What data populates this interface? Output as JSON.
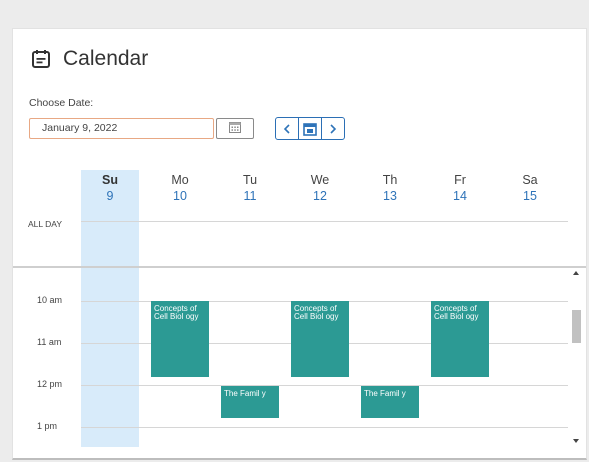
{
  "header": {
    "title": "Calendar",
    "icon": "calendar-icon"
  },
  "date_picker": {
    "label": "Choose Date:",
    "value": "January 9, 2022",
    "button_icon": "calendar-grid-icon"
  },
  "nav": {
    "prev_icon": "chevron-left-icon",
    "today_icon": "calendar-today-icon",
    "next_icon": "chevron-right-icon"
  },
  "days": [
    {
      "name": "Su",
      "num": "9",
      "today": true
    },
    {
      "name": "Mo",
      "num": "10"
    },
    {
      "name": "Tu",
      "num": "11"
    },
    {
      "name": "We",
      "num": "12"
    },
    {
      "name": "Th",
      "num": "13"
    },
    {
      "name": "Fr",
      "num": "14"
    },
    {
      "name": "Sa",
      "num": "15"
    }
  ],
  "allday_label": "ALL DAY",
  "times": [
    "10 am",
    "11 am",
    "12 pm",
    "1 pm"
  ],
  "events": [
    {
      "day": "Mo",
      "text": "Concepts of Cell Biol ogy"
    },
    {
      "day": "Tu",
      "text": "The Famil y"
    },
    {
      "day": "We",
      "text": "Concepts of Cell Biol ogy"
    },
    {
      "day": "Th",
      "text": "The Famil y"
    },
    {
      "day": "Fr",
      "text": "Concepts of Cell Biol ogy"
    }
  ],
  "colors": {
    "accent": "#2e73b8",
    "event": "#2c9a94",
    "today_column": "#d8ebfa",
    "input_border": "#e8a884"
  }
}
